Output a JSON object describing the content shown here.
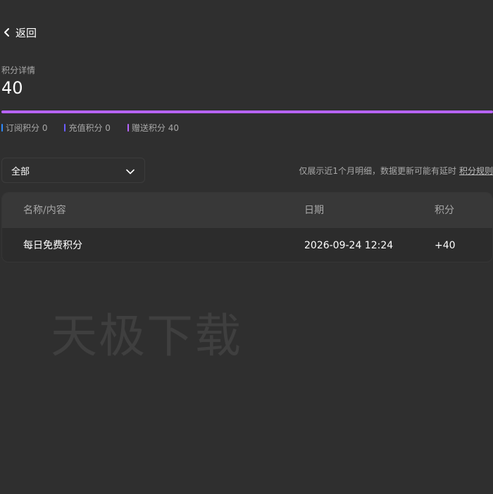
{
  "nav": {
    "back_label": "返回"
  },
  "summary": {
    "label": "积分详情",
    "total": "40"
  },
  "breakdown": {
    "bar_colors": {
      "subscription": "#2f8bff",
      "recharge": "#6b5cff",
      "gift": "#b764ff"
    },
    "bar_fractions": {
      "subscription": 0,
      "recharge": 0,
      "gift": 1
    },
    "items": [
      {
        "label": "订阅积分 0",
        "color": "#2f8bff"
      },
      {
        "label": "充值积分 0",
        "color": "#6b5cff"
      },
      {
        "label": "赠送积分 40",
        "color": "#b764ff"
      }
    ]
  },
  "filter": {
    "value": "全部"
  },
  "notice": {
    "text": "仅展示近1个月明细，数据更新可能有延时",
    "link_label": "积分规则"
  },
  "table": {
    "headers": [
      "名称/内容",
      "日期",
      "积分"
    ],
    "rows": [
      [
        "每日免费积分",
        "2026-09-24 12:24",
        "+40"
      ]
    ]
  },
  "watermark": "天极下载"
}
